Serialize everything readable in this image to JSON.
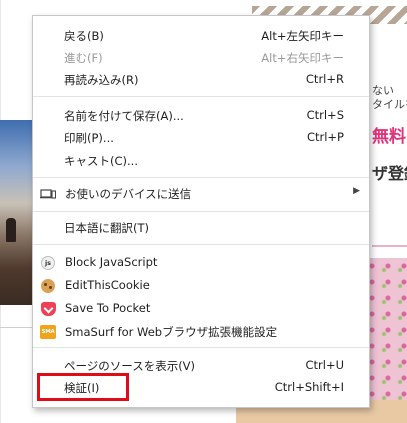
{
  "menu": {
    "items": [
      {
        "label": "戻る(B)",
        "shortcut": "Alt+左矢印キー",
        "enabled": true
      },
      {
        "label": "進む(F)",
        "shortcut": "Alt+右矢印キー",
        "enabled": false
      },
      {
        "label": "再読み込み(R)",
        "shortcut": "Ctrl+R",
        "enabled": true
      },
      {
        "label": "名前を付けて保存(A)...",
        "shortcut": "Ctrl+S",
        "enabled": true
      },
      {
        "label": "印刷(P)...",
        "shortcut": "Ctrl+P",
        "enabled": true
      },
      {
        "label": "キャスト(C)...",
        "shortcut": "",
        "enabled": true
      },
      {
        "label": "お使いのデバイスに送信",
        "shortcut": "",
        "enabled": true,
        "icon": "device-icon",
        "submenu_indicator": "▶"
      },
      {
        "label": "日本語に翻訳(T)",
        "shortcut": "",
        "enabled": true
      },
      {
        "label": "Block JavaScript",
        "shortcut": "",
        "enabled": true,
        "icon": "js-extension-icon",
        "icon_text": "js"
      },
      {
        "label": "EditThisCookie",
        "shortcut": "",
        "enabled": true,
        "icon": "cookie-icon"
      },
      {
        "label": "Save To Pocket",
        "shortcut": "",
        "enabled": true,
        "icon": "pocket-icon"
      },
      {
        "label": "SmaSurf for Webブラウザ拡張機能設定",
        "shortcut": "",
        "enabled": true,
        "icon": "smasurf-icon",
        "icon_text": "SMA"
      },
      {
        "label": "ページのソースを表示(V)",
        "shortcut": "Ctrl+U",
        "enabled": true
      },
      {
        "label": "検証(I)",
        "shortcut": "Ctrl+Shift+I",
        "enabled": true,
        "highlighted": true
      }
    ]
  },
  "background_page": {
    "text_line_1": "ない",
    "text_line_2": "タイルを",
    "text_line_3": "無料",
    "text_line_4": "ザ登録"
  },
  "colors": {
    "highlight_border": "#e00b17",
    "free_text": "#e2337a",
    "pocket_red": "#ef4056",
    "smasurf_orange": "#f3a21b",
    "disabled_text": "#9a9a9a"
  }
}
